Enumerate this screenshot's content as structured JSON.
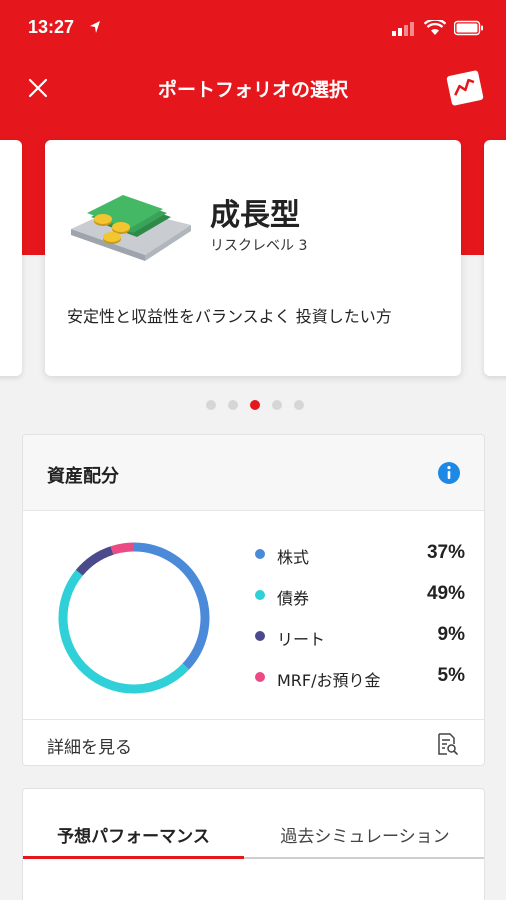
{
  "status_bar": {
    "time": "13:27"
  },
  "nav": {
    "title": "ポートフォリオの選択"
  },
  "portfolio_card": {
    "title": "成長型",
    "risk_level": "リスクレベル 3",
    "description": "安定性と収益性をバランスよく 投資したい方"
  },
  "pagination": {
    "count": 5,
    "active_index": 2
  },
  "asset_allocation": {
    "title": "資産配分",
    "items": [
      {
        "label": "株式",
        "value": "37%",
        "percent": 37,
        "color": "#4a8ad9"
      },
      {
        "label": "債券",
        "value": "49%",
        "percent": 49,
        "color": "#2fd0d8"
      },
      {
        "label": "リート",
        "value": "9%",
        "percent": 9,
        "color": "#4b4a8c"
      },
      {
        "label": "MRF/お預り金",
        "value": "5%",
        "percent": 5,
        "color": "#ea4b84"
      }
    ],
    "detail_label": "詳細を見る"
  },
  "performance_tabs": [
    {
      "label": "予想パフォーマンス",
      "active": true
    },
    {
      "label": "過去シミュレーション",
      "active": false
    }
  ],
  "colors": {
    "brand_red": "#e5171c",
    "info_blue": "#1e88e5"
  }
}
